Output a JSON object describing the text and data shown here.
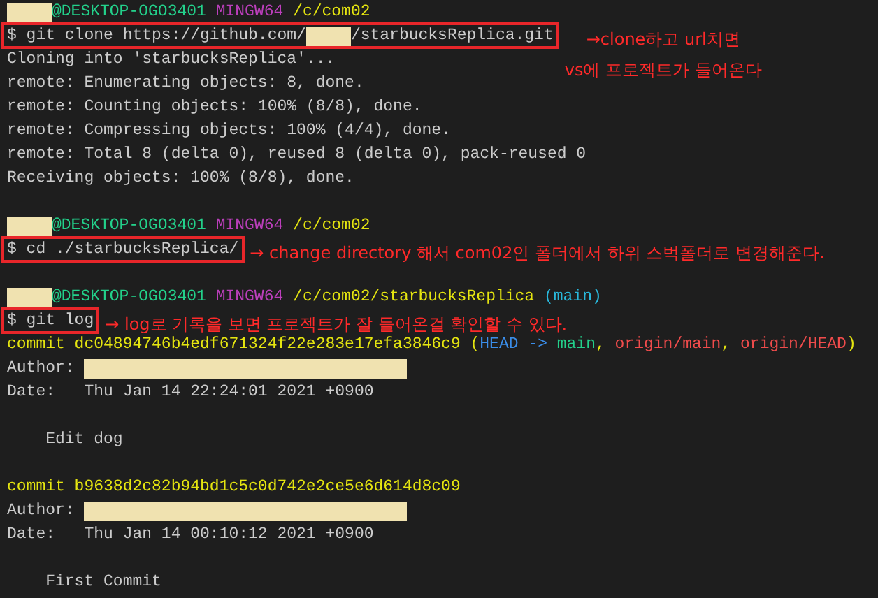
{
  "terminal": {
    "lines": [
      {
        "kind": "prompt",
        "segments": [
          {
            "kind": "redacted"
          },
          {
            "kind": "host",
            "text": "@DESKTOP-OGO3401"
          },
          {
            "kind": "shell",
            "text": " MINGW64"
          },
          {
            "kind": "path",
            "text": " /c/com02"
          }
        ]
      },
      {
        "kind": "command",
        "boxed": true,
        "segments": [
          {
            "kind": "plain",
            "text": "$ git clone https://github.com/"
          },
          {
            "kind": "redacted"
          },
          {
            "kind": "plain",
            "text": "/starbucksReplica.git"
          }
        ],
        "note": [
          "→clone하고 url치면",
          "vs에 프로젝트가 들어온다"
        ]
      },
      {
        "kind": "output",
        "segments": [
          {
            "kind": "plain",
            "text": "Cloning into 'starbucksReplica'..."
          }
        ]
      },
      {
        "kind": "output",
        "segments": [
          {
            "kind": "plain",
            "text": "remote: Enumerating objects: 8, done."
          }
        ]
      },
      {
        "kind": "output",
        "segments": [
          {
            "kind": "plain",
            "text": "remote: Counting objects: 100% (8/8), done."
          }
        ]
      },
      {
        "kind": "output",
        "segments": [
          {
            "kind": "plain",
            "text": "remote: Compressing objects: 100% (4/4), done."
          }
        ]
      },
      {
        "kind": "output",
        "segments": [
          {
            "kind": "plain",
            "text": "remote: Total 8 (delta 0), reused 8 (delta 0), pack-reused 0"
          }
        ]
      },
      {
        "kind": "output",
        "segments": [
          {
            "kind": "plain",
            "text": "Receiving objects: 100% (8/8), done."
          }
        ]
      },
      {
        "kind": "blank"
      },
      {
        "kind": "prompt",
        "segments": [
          {
            "kind": "redacted"
          },
          {
            "kind": "host",
            "text": "@DESKTOP-OGO3401"
          },
          {
            "kind": "shell",
            "text": " MINGW64"
          },
          {
            "kind": "path",
            "text": " /c/com02"
          }
        ]
      },
      {
        "kind": "command",
        "boxed": true,
        "segments": [
          {
            "kind": "plain",
            "text": "$ cd ./starbucksReplica/"
          }
        ],
        "note": [
          "→ change directory 해서 com02인 폴더에서 하위 스벅폴더로 변경해준다."
        ]
      },
      {
        "kind": "blank"
      },
      {
        "kind": "prompt",
        "segments": [
          {
            "kind": "redacted"
          },
          {
            "kind": "host",
            "text": "@DESKTOP-OGO3401"
          },
          {
            "kind": "shell",
            "text": " MINGW64"
          },
          {
            "kind": "path",
            "text": " /c/com02/starbucksReplica"
          },
          {
            "kind": "branch",
            "text": " (main)"
          }
        ]
      },
      {
        "kind": "command",
        "boxed": true,
        "segments": [
          {
            "kind": "plain",
            "text": "$ git log"
          }
        ],
        "note": [
          "→ log로 기록을 보면 프로젝트가 잘 들어온걸 확인할 수 있다."
        ]
      },
      {
        "kind": "output",
        "segments": [
          {
            "kind": "hash",
            "text": "commit dc04894746b4edf671324f22e283e17efa3846c9 ("
          },
          {
            "kind": "head",
            "text": "HEAD -> "
          },
          {
            "kind": "local",
            "text": "main"
          },
          {
            "kind": "hash",
            "text": ", "
          },
          {
            "kind": "remote",
            "text": "origin/main"
          },
          {
            "kind": "hash",
            "text": ", "
          },
          {
            "kind": "remote",
            "text": "origin/HEAD"
          },
          {
            "kind": "hash",
            "text": ")"
          }
        ]
      },
      {
        "kind": "output",
        "segments": [
          {
            "kind": "plain",
            "text": "Author: "
          },
          {
            "kind": "redacted-long"
          }
        ]
      },
      {
        "kind": "output",
        "segments": [
          {
            "kind": "plain",
            "text": "Date:   Thu Jan 14 22:24:01 2021 +0900"
          }
        ]
      },
      {
        "kind": "blank"
      },
      {
        "kind": "output",
        "segments": [
          {
            "kind": "plain",
            "text": "    Edit dog"
          }
        ]
      },
      {
        "kind": "blank"
      },
      {
        "kind": "output",
        "segments": [
          {
            "kind": "hash",
            "text": "commit b9638d2c82b94bd1c5c0d742e2ce5e6d614d8c09"
          }
        ]
      },
      {
        "kind": "output",
        "segments": [
          {
            "kind": "plain",
            "text": "Author: "
          },
          {
            "kind": "redacted-long"
          }
        ]
      },
      {
        "kind": "output",
        "segments": [
          {
            "kind": "plain",
            "text": "Date:   Thu Jan 14 00:10:12 2021 +0900"
          }
        ]
      },
      {
        "kind": "blank"
      },
      {
        "kind": "output",
        "segments": [
          {
            "kind": "plain",
            "text": "    First Commit"
          }
        ]
      }
    ]
  }
}
